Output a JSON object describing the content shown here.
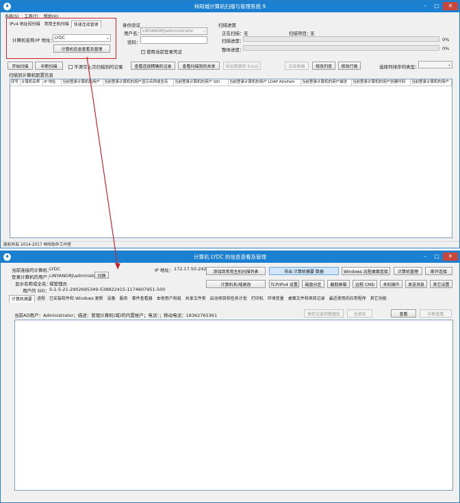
{
  "win1": {
    "title": "林阳城计算机扫描与管理系统 9",
    "menu": [
      "系统(S)",
      "工具(T)",
      "帮助(H)"
    ],
    "tabs": [
      "IPv4 地址段扫描",
      "常用主机扫描",
      "快速连接管理"
    ],
    "host_label": "计算机名称/IP 地址：",
    "host_value": "LYDC",
    "view_button": "计算机信息查看及管理",
    "auth_title": "身份验证",
    "user_label": "用户名：",
    "user_value": "LINYANGRJ\\administrator",
    "password_label": "密码：",
    "use_current_label": "使用当前登录凭证",
    "progress_title": "扫描进度",
    "scanning_label": "正在扫描：",
    "scanning_value": "无",
    "scan_item_label": "扫描项目：",
    "scan_item_value": "无",
    "scan_progress_label": "扫描进度：",
    "scan_progress_value": "0%",
    "scan_progress_fraction": 0,
    "total_progress_label": "整体进度：",
    "total_progress_value": "0%",
    "total_progress_fraction": 0,
    "toolbar": {
      "start": "开始扫描",
      "stop": "中断扫描",
      "keep_records": "不清空上次扫描到的记录",
      "view_online": "查看连接精确的记录",
      "view_shares": "查看扫描到的共享",
      "export_excel": "导出数据到 Excel",
      "freeze": "冻结表格",
      "edit_columns": "修改列宽",
      "edit_rows": "修改行高",
      "sort_label": "选择列排序的类型："
    },
    "result_title": "扫描到计算机配置信息",
    "columns": [
      "序号",
      "计算机名称",
      "IP 地址",
      "当前登录计算机的用户",
      "当前登录计算机的用户显示名称或全名",
      "当前登录计算机的用户 SID",
      "当前登录计算机的用户 LDAP ADsPath",
      "当前登录计算机的用户描述",
      "当前登录计算机的用户创建时间",
      "当前登录计算机的用户"
    ],
    "status": "版权所有 2014-2017 林阳软件工作室"
  },
  "win2": {
    "title": "计算机 LYDC 的信息查看及管理",
    "connected_label": "当前连接的计算机：",
    "connected_value": "LYDC",
    "login_user_label": "登录计算机的用户：",
    "login_user_value": "LINYANGRJ\\administrator",
    "switch_button": "切换",
    "display_name_label": "显示名称或全名：",
    "display_name_value": "域管理员",
    "sid_label": "用户的 SID：",
    "sid_value": "S-1-5-21-2902695349-538822415-1174607951-500",
    "ip_label": "IP 地址：",
    "ip_value": "172.17.50.242",
    "buttons_row1": [
      "添加到常用主机扫描列表",
      "导出 计算机摘要 数据",
      "Windows 远程桌面连接",
      "计算机管理",
      "断开连接"
    ],
    "buttons_row2": [
      "计算机名/域更改",
      "TCP/IPv4 设置",
      "磁盘分区",
      "截取屏幕",
      "远程 CMD",
      "关机操作",
      "发送消息",
      "其它设置"
    ],
    "tabs": [
      "计算机摘要",
      "进程",
      "已安装软件和 Windows 更新",
      "设备",
      "服务",
      "事件查看器",
      "本地用户和组",
      "共享文件夹",
      "启动项目和任务计划",
      "打印机",
      "环境变量",
      "桌面文件和项目记录",
      "最近使用的应用程序",
      "其它功能"
    ],
    "info_line": "当前AD用户：Administrator；描述：管理计算机(域)的内置帐户；电话：；移动电话：18362765361",
    "save_button": "保存记录到数据库",
    "all_button": "全部显",
    "view_button": "查看",
    "stop_button": "中断查看"
  },
  "colors": {
    "titlebar": "#1c80d2",
    "highlight": "#c8232c",
    "close": "#c9463d"
  }
}
